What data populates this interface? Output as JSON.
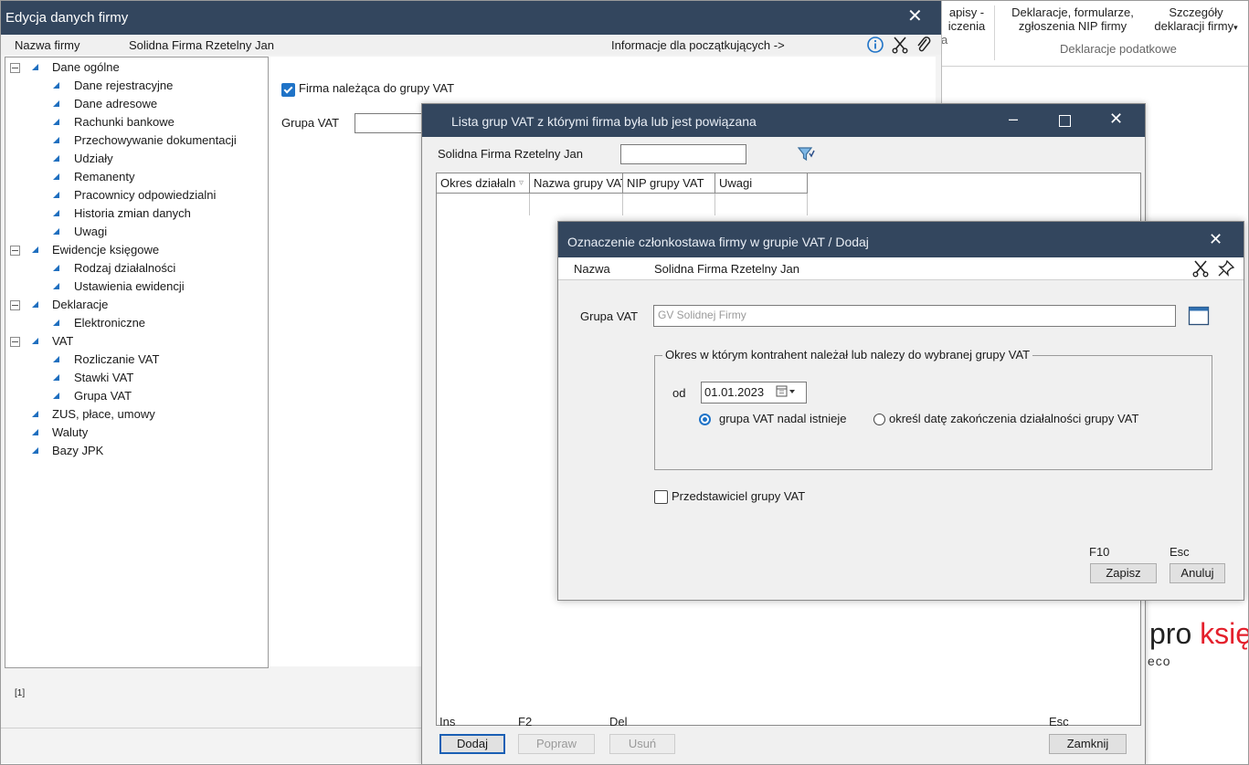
{
  "ribbon": {
    "btn1_line1": "apisy -",
    "btn1_line2": "iczenia",
    "btn1_line3": "a",
    "btn2_line1": "Deklaracje, formularze,",
    "btn2_line2": "zgłoszenia NIP firmy",
    "btn3_line1": "Szczegóły",
    "btn3_line2": "deklaracji firmy",
    "group_label": "Deklaracje podatkowe"
  },
  "brand": {
    "text_dark": "pro ",
    "text_red": "księ",
    "sub": "eco"
  },
  "win1": {
    "title": "Edycja danych firmy",
    "info_label": "Nazwa firmy",
    "info_value": "Solidna Firma Rzetelny Jan",
    "beginners_link": "Informacje dla początkujących ->",
    "tree": [
      {
        "label": "Dane ogólne",
        "level": 0,
        "expand": true
      },
      {
        "label": "Dane rejestracyjne",
        "level": 1
      },
      {
        "label": "Dane adresowe",
        "level": 1
      },
      {
        "label": "Rachunki bankowe",
        "level": 1
      },
      {
        "label": "Przechowywanie dokumentacji",
        "level": 1
      },
      {
        "label": "Udziały",
        "level": 1
      },
      {
        "label": "Remanenty",
        "level": 1
      },
      {
        "label": "Pracownicy odpowiedzialni",
        "level": 1
      },
      {
        "label": "Historia zmian danych",
        "level": 1
      },
      {
        "label": "Uwagi",
        "level": 1
      },
      {
        "label": "Ewidencje księgowe",
        "level": 0,
        "expand": true
      },
      {
        "label": "Rodzaj działalności",
        "level": 1
      },
      {
        "label": "Ustawienia ewidencji",
        "level": 1
      },
      {
        "label": "Deklaracje",
        "level": 0,
        "expand": true
      },
      {
        "label": "Elektroniczne",
        "level": 1
      },
      {
        "label": "VAT",
        "level": 0,
        "expand": true
      },
      {
        "label": "Rozliczanie VAT",
        "level": 1
      },
      {
        "label": "Stawki VAT",
        "level": 1
      },
      {
        "label": "Grupa VAT",
        "level": 1
      },
      {
        "label": "ZUS, płace, umowy",
        "level": 0,
        "expand": false
      },
      {
        "label": "Waluty",
        "level": 0,
        "expand": false
      },
      {
        "label": "Bazy JPK",
        "level": 0,
        "expand": false
      }
    ],
    "vat_group_checkbox": "Firma należąca do grupy VAT",
    "vat_group_checked": true,
    "vat_group_label": "Grupa VAT",
    "status_text": "[1]"
  },
  "win2": {
    "title": "Lista grup VAT z którymi firma była lub jest powiązana",
    "filter_label": "Solidna Firma Rzetelny Jan",
    "columns": [
      "Okres działaln",
      "Nazwa grupy VAT",
      "NIP grupy VAT",
      "Uwagi"
    ],
    "buttons": [
      {
        "key": "Ins",
        "label": "Dodaj",
        "enabled": true
      },
      {
        "key": "F2",
        "label": "Popraw",
        "enabled": false
      },
      {
        "key": "Del",
        "label": "Usuń",
        "enabled": false
      }
    ],
    "close_key": "Esc",
    "close_label": "Zamknij"
  },
  "win3": {
    "title": "Oznaczenie członkostawa firmy w grupie VAT / Dodaj",
    "name_label": "Nazwa",
    "name_value": "Solidna Firma Rzetelny Jan",
    "group_label": "Grupa VAT",
    "group_value": "GV Solidnej Firmy",
    "period_legend": "Okres w którym kontrahent należał lub nalezy do wybranej grupy VAT",
    "from_label": "od",
    "from_date": "01.01.2023",
    "radio_exists": "grupa VAT nadal istnieje",
    "radio_end": "określ datę zakończenia działalności grupy VAT",
    "radio_selected": "exists",
    "representative_label": "Przedstawiciel grupy VAT",
    "representative_checked": false,
    "save_key": "F10",
    "save_label": "Zapisz",
    "cancel_key": "Esc",
    "cancel_label": "Anuluj"
  },
  "colors": {
    "titlebar": "#33465e",
    "accent": "#1f73c7",
    "brand_red": "#e4202c"
  }
}
